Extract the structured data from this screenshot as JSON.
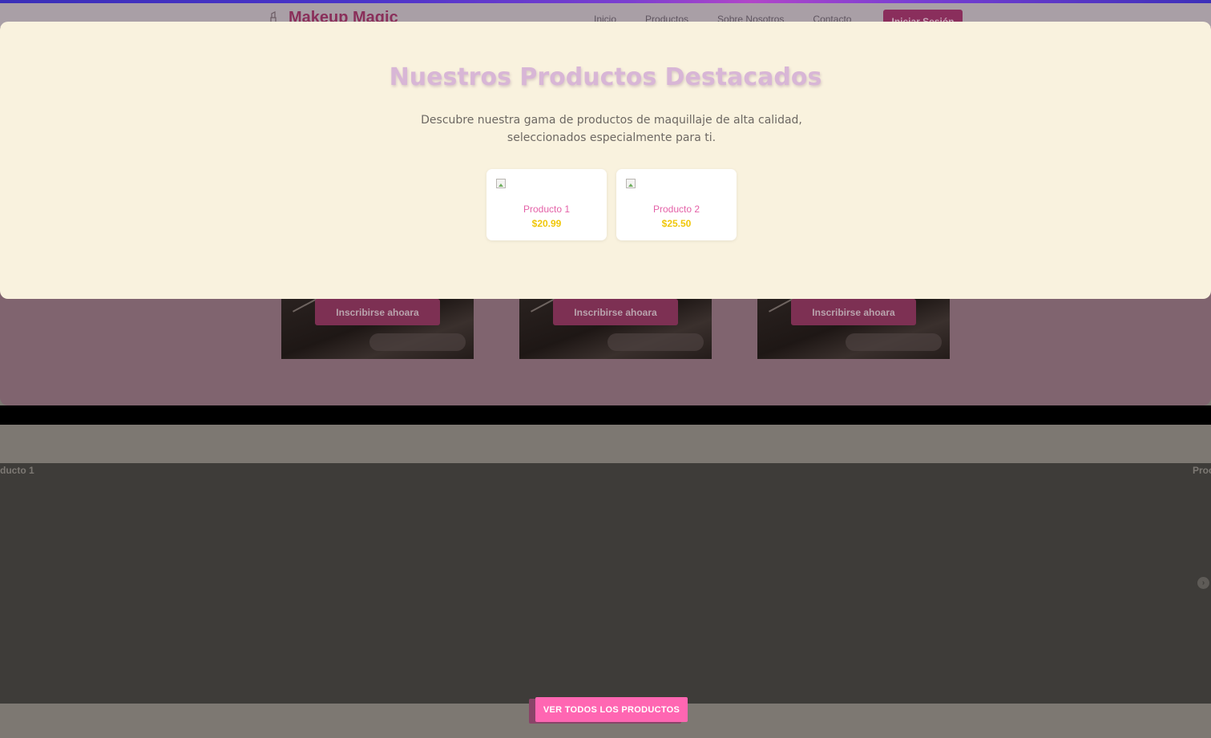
{
  "brand": {
    "name": "Makeup Magic",
    "logo_icon": "lipstick-icon"
  },
  "nav": {
    "links": [
      "Inicio",
      "Productos",
      "Sobre Nosotros",
      "Contacto"
    ],
    "login_label": "Iniciar Sesión"
  },
  "courses": [
    {
      "button_label": "Inscribirse ahoara"
    },
    {
      "button_label": "Inscribirse ahoara"
    },
    {
      "button_label": "Inscribirse ahoara"
    }
  ],
  "carousel": {
    "left_label": "ducto 1",
    "right_label": "Proc",
    "prev_icon": "chevron-left-icon",
    "next_icon": "chevron-right-icon"
  },
  "all_products_label": "VER TODOS LOS PRODUCTOS",
  "modal": {
    "title": "Nuestros Productos Destacados",
    "description_line1": "Descubre nuestra gama de productos de maquillaje de alta calidad,",
    "description_line2": "seleccionados especialmente para ti.",
    "products": [
      {
        "name": "Producto 1",
        "price": "$20.99"
      },
      {
        "name": "Producto 2",
        "price": "$25.50"
      }
    ]
  },
  "colors": {
    "accent_pink": "#ff66b2",
    "price_yellow": "#f0c70a",
    "modal_bg": "#f9f2de",
    "title_lavender": "#d8b6d6"
  }
}
